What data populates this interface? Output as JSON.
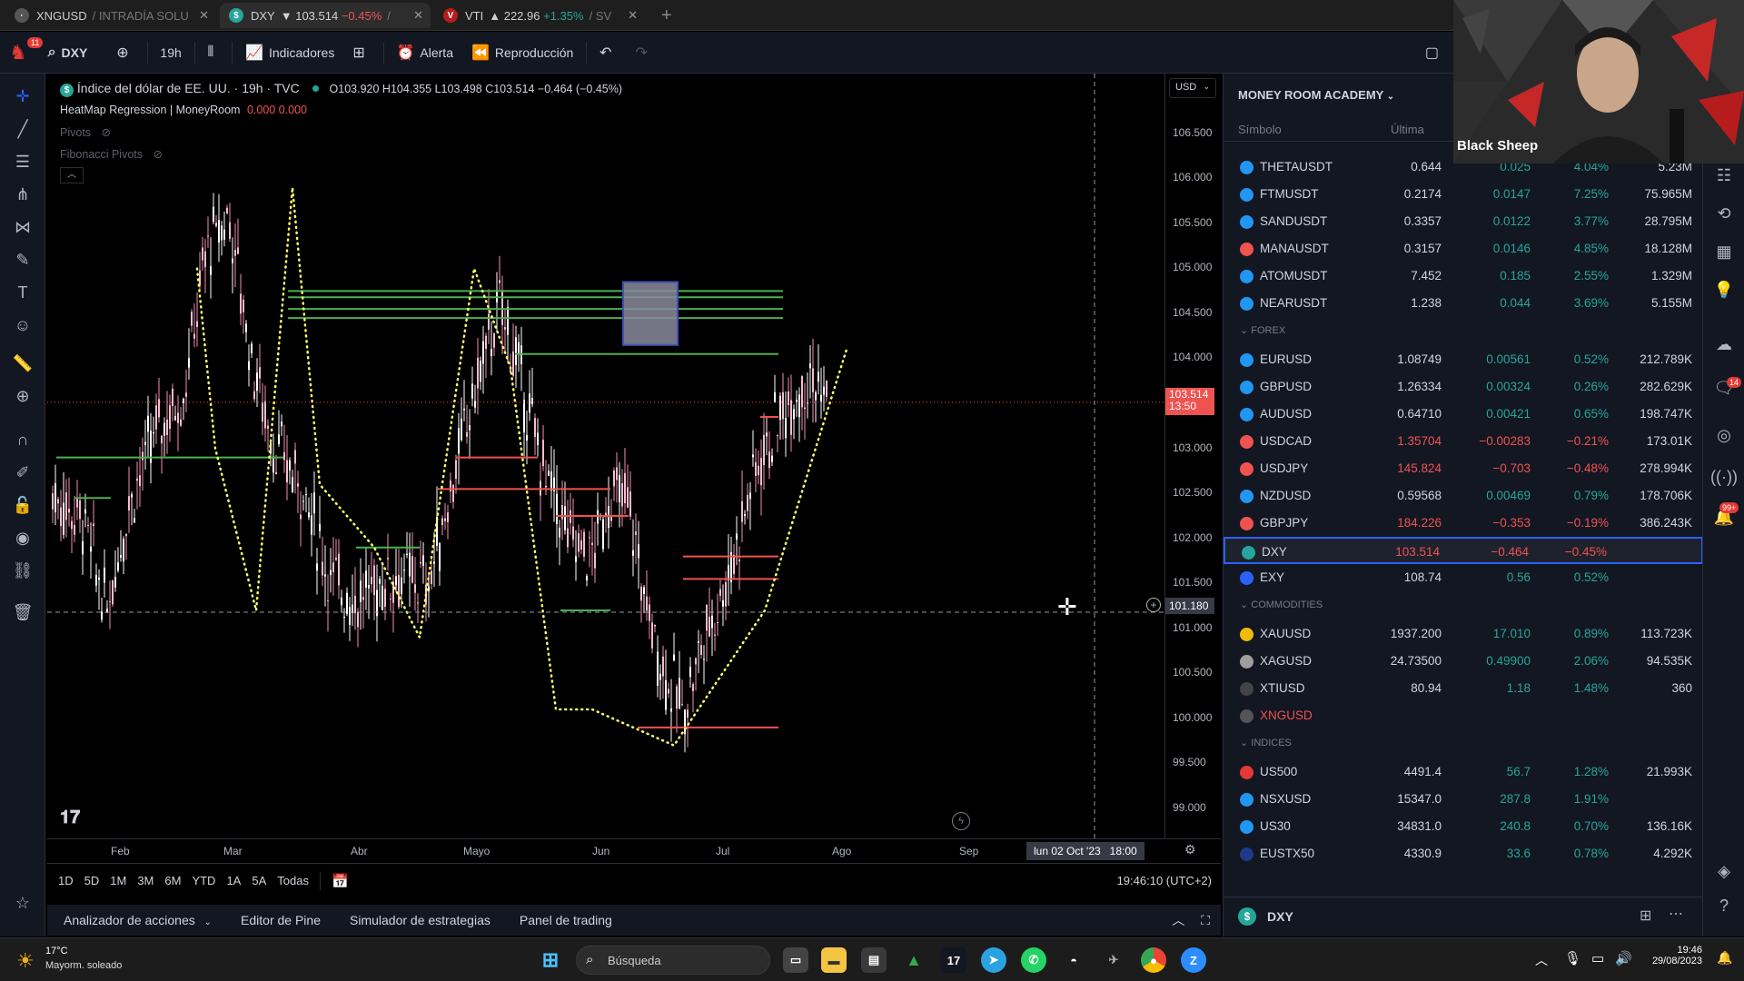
{
  "browser_tabs": [
    {
      "label": "XNGUSD",
      "suffix": "/ INTRADÍA SOLU"
    },
    {
      "label": "DXY",
      "price": "▼ 103.514",
      "change": "−0.45%",
      "suffix": "/ "
    },
    {
      "label": "VTI",
      "price": "▲ 222.96",
      "change": "+1.35%",
      "suffix": "/ SV"
    }
  ],
  "toolbar": {
    "notif_count": "11",
    "symbol": "DXY",
    "interval": "19h",
    "indicators": "Indicadores",
    "alert": "Alerta",
    "replay": "Reproducción"
  },
  "legend": {
    "title": "Índice del dólar de EE. UU. · 19h · TVC",
    "ohlc": "O103.920 H104.355 L103.498 C103.514 −0.464 (−0.45%)",
    "ind1_name": "HeatMap Regression | MoneyRoom",
    "ind1_values": "0.000 0.000",
    "ind2": "Pivots",
    "ind3": "Fibonacci Pivots"
  },
  "currency": "USD",
  "price_labels": [
    "106.500",
    "106.000",
    "105.500",
    "105.000",
    "104.500",
    "104.000",
    "103.000",
    "102.500",
    "102.000",
    "101.500",
    "101.000",
    "100.500",
    "100.000",
    "99.500",
    "99.000"
  ],
  "current_price": {
    "price": "103.514",
    "countdown": "13:50"
  },
  "crosshair_price": "101.180",
  "time_labels": [
    "Feb",
    "Mar",
    "Abr",
    "Mayo",
    "Jun",
    "Jul",
    "Ago",
    "Sep"
  ],
  "crosshair_time": "lun 02 Oct '23   18:00",
  "ranges": [
    "1D",
    "5D",
    "1M",
    "3M",
    "6M",
    "YTD",
    "1A",
    "5A",
    "Todas"
  ],
  "clock": "19:46:10 (UTC+2)",
  "bottom_tabs": [
    "Analizador de acciones",
    "Editor de Pine",
    "Simulador de estrategias",
    "Panel de trading"
  ],
  "watchlist": {
    "title": "MONEY ROOM ACADEMY",
    "col_symbol": "Símbolo",
    "col_last": "Última",
    "rows": [
      {
        "sym": "THETAUSDT",
        "last": "0.644",
        "chg": "0.025",
        "pct": "4.04%",
        "vol": "5.23M",
        "dir": "up",
        "color": "#2196f3"
      },
      {
        "sym": "FTMUSDT",
        "last": "0.2174",
        "chg": "0.0147",
        "pct": "7.25%",
        "vol": "75.965M",
        "dir": "up",
        "color": "#2196f3"
      },
      {
        "sym": "SANDUSDT",
        "last": "0.3357",
        "chg": "0.0122",
        "pct": "3.77%",
        "vol": "28.795M",
        "dir": "up",
        "color": "#2196f3"
      },
      {
        "sym": "MANAUSDT",
        "last": "0.3157",
        "chg": "0.0146",
        "pct": "4.85%",
        "vol": "18.128M",
        "dir": "up",
        "color": "#ef5350"
      },
      {
        "sym": "ATOMUSDT",
        "last": "7.452",
        "chg": "0.185",
        "pct": "2.55%",
        "vol": "1.329M",
        "dir": "up",
        "color": "#2196f3"
      },
      {
        "sym": "NEARUSDT",
        "last": "1.238",
        "chg": "0.044",
        "pct": "3.69%",
        "vol": "5.155M",
        "dir": "up",
        "color": "#2196f3"
      }
    ],
    "forex_label": "FOREX",
    "forex": [
      {
        "sym": "EURUSD",
        "last": "1.08749",
        "chg": "0.00561",
        "pct": "0.52%",
        "vol": "212.789K",
        "dir": "up",
        "color": "#2196f3"
      },
      {
        "sym": "GBPUSD",
        "last": "1.26334",
        "chg": "0.00324",
        "pct": "0.26%",
        "vol": "282.629K",
        "dir": "up",
        "color": "#2196f3"
      },
      {
        "sym": "AUDUSD",
        "last": "0.64710",
        "chg": "0.00421",
        "pct": "0.65%",
        "vol": "198.747K",
        "dir": "up",
        "color": "#2196f3"
      },
      {
        "sym": "USDCAD",
        "last": "1.35704",
        "chg": "−0.00283",
        "pct": "−0.21%",
        "vol": "173.01K",
        "dir": "dn",
        "color": "#ef5350"
      },
      {
        "sym": "USDJPY",
        "last": "145.824",
        "chg": "−0.703",
        "pct": "−0.48%",
        "vol": "278.994K",
        "dir": "dn",
        "color": "#ef5350"
      },
      {
        "sym": "NZDUSD",
        "last": "0.59568",
        "chg": "0.00469",
        "pct": "0.79%",
        "vol": "178.706K",
        "dir": "up",
        "color": "#2196f3"
      },
      {
        "sym": "GBPJPY",
        "last": "184.226",
        "chg": "−0.353",
        "pct": "−0.19%",
        "vol": "386.243K",
        "dir": "dn",
        "color": "#ef5350"
      },
      {
        "sym": "DXY",
        "last": "103.514",
        "chg": "−0.464",
        "pct": "−0.45%",
        "vol": "",
        "dir": "dn",
        "color": "#26a69a",
        "selected": true
      },
      {
        "sym": "EXY",
        "last": "108.74",
        "chg": "0.56",
        "pct": "0.52%",
        "vol": "",
        "dir": "up",
        "color": "#2962ff"
      }
    ],
    "commodities_label": "COMMODITIES",
    "commodities": [
      {
        "sym": "XAUUSD",
        "last": "1937.200",
        "chg": "17.010",
        "pct": "0.89%",
        "vol": "113.723K",
        "dir": "up",
        "color": "#f0b90b"
      },
      {
        "sym": "XAGUSD",
        "last": "24.73500",
        "chg": "0.49900",
        "pct": "2.06%",
        "vol": "94.535K",
        "dir": "up",
        "color": "#9e9e9e"
      },
      {
        "sym": "XTIUSD",
        "last": "80.94",
        "chg": "1.18",
        "pct": "1.48%",
        "vol": "360",
        "dir": "up",
        "color": "#444"
      },
      {
        "sym": "XNGUSD",
        "last": "",
        "chg": "",
        "pct": "",
        "vol": "",
        "dir": "dn",
        "color": "#555"
      }
    ],
    "indices_label": "INDICES",
    "indices": [
      {
        "sym": "US500",
        "last": "4491.4",
        "chg": "56.7",
        "pct": "1.28%",
        "vol": "21.993K",
        "dir": "up",
        "color": "#e53935"
      },
      {
        "sym": "NSXUSD",
        "last": "15347.0",
        "chg": "287.8",
        "pct": "1.91%",
        "vol": "",
        "dir": "up",
        "color": "#2196f3"
      },
      {
        "sym": "US30",
        "last": "34831.0",
        "chg": "240.8",
        "pct": "0.70%",
        "vol": "136.16K",
        "dir": "up",
        "color": "#2196f3"
      },
      {
        "sym": "EUSTX50",
        "last": "4330.9",
        "chg": "33.6",
        "pct": "0.78%",
        "vol": "4.292K",
        "dir": "up",
        "color": "#1e3a8a"
      }
    ],
    "footer_symbol": "DXY"
  },
  "webcam_name": "Black Sheep",
  "right_badges": {
    "b1": "14",
    "b2": "99+"
  },
  "taskbar": {
    "temp": "17°C",
    "weather": "Mayorm. soleado",
    "search": "Búsqueda",
    "time": "19:46",
    "date": "29/08/2023"
  }
}
